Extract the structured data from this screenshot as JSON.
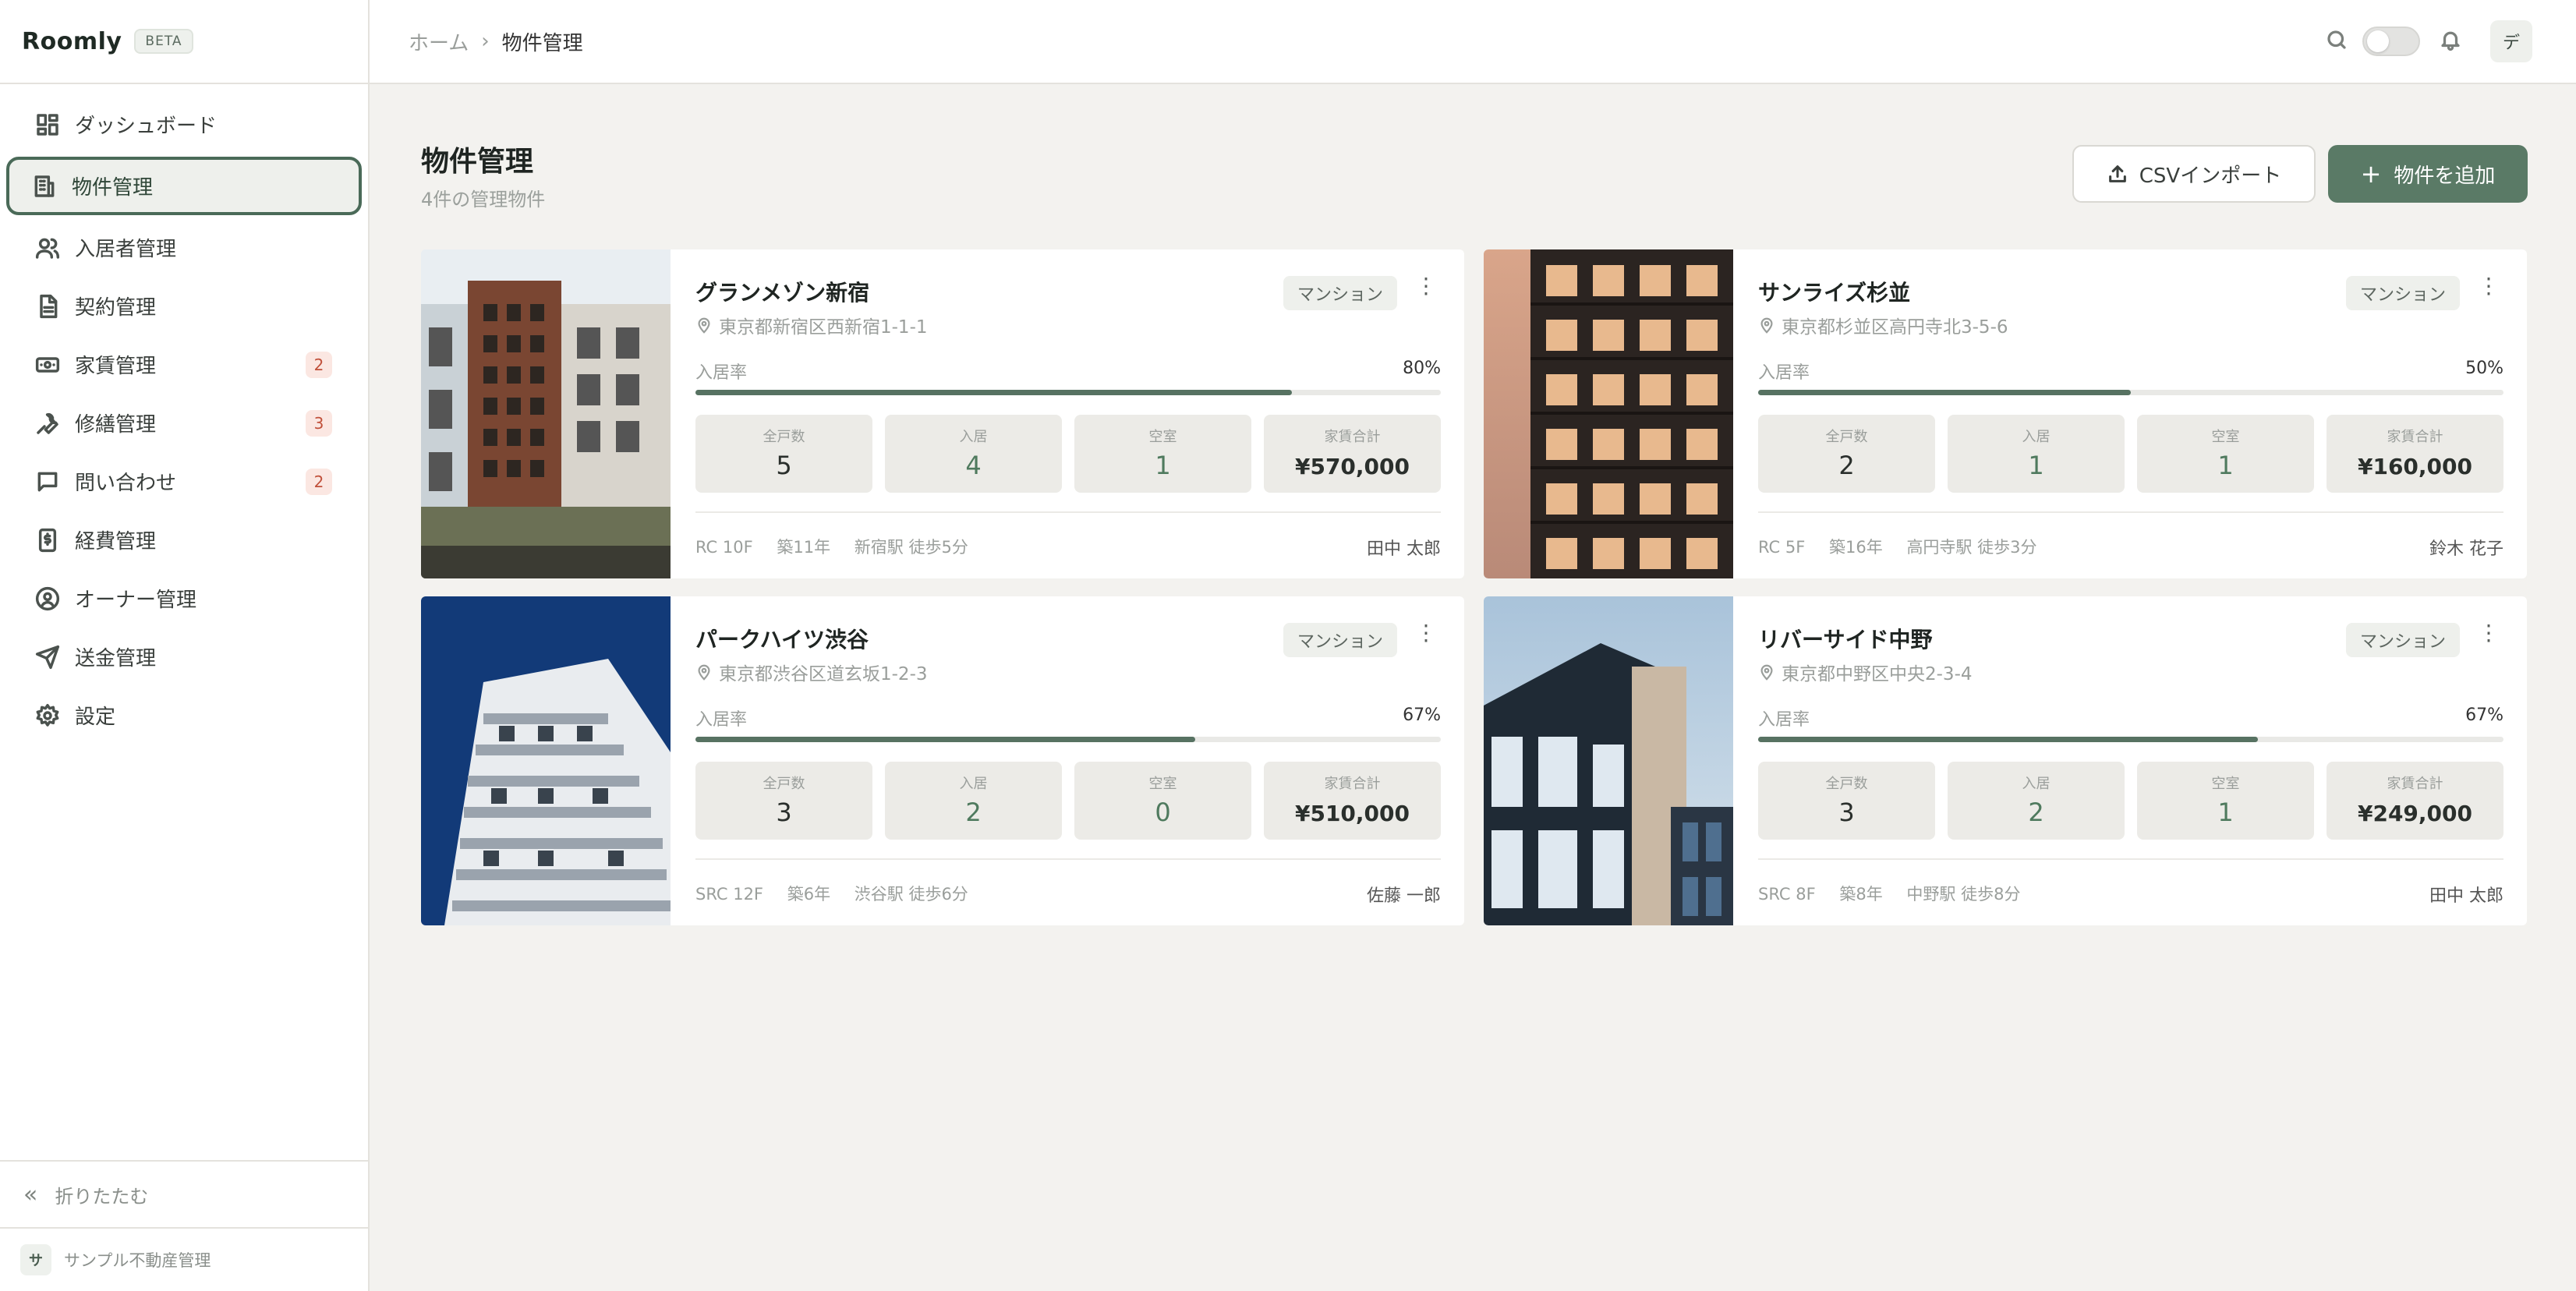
{
  "app": {
    "name": "Roomly",
    "badge": "BETA"
  },
  "sidebar": {
    "items": [
      {
        "label": "ダッシュボード",
        "icon": "dashboard-icon"
      },
      {
        "label": "物件管理",
        "icon": "building-icon",
        "active": true
      },
      {
        "label": "入居者管理",
        "icon": "users-icon"
      },
      {
        "label": "契約管理",
        "icon": "document-icon"
      },
      {
        "label": "家賃管理",
        "icon": "banknote-icon",
        "badge": "2"
      },
      {
        "label": "修繕管理",
        "icon": "wrench-icon",
        "badge": "3"
      },
      {
        "label": "問い合わせ",
        "icon": "message-icon",
        "badge": "2"
      },
      {
        "label": "経費管理",
        "icon": "receipt-icon"
      },
      {
        "label": "オーナー管理",
        "icon": "user-circle-icon"
      },
      {
        "label": "送金管理",
        "icon": "send-icon"
      },
      {
        "label": "設定",
        "icon": "gear-icon"
      }
    ],
    "collapse_label": "折りたたむ",
    "org_initial": "サ",
    "org_name": "サンプル不動産管理"
  },
  "topbar": {
    "breadcrumb_home": "ホーム",
    "breadcrumb_separator": "›",
    "breadcrumb_current": "物件管理",
    "user_initial": "デ"
  },
  "page": {
    "title": "物件管理",
    "subtitle": "4件の管理物件",
    "import_label": "CSVインポート",
    "add_label": "物件を追加"
  },
  "colors": {
    "accent": "#5a7a66",
    "badge_bg": "#fbe7e2",
    "badge_text": "#c0503a"
  },
  "properties": [
    {
      "name": "グランメゾン新宿",
      "address": "東京都新宿区西新宿1-1-1",
      "type": "マンション",
      "occupancy_label": "入居率",
      "occupancy": "80%",
      "occupancy_rate": 0.8,
      "stats": {
        "total_label": "全戸数",
        "total": "5",
        "occupied_label": "入居",
        "occupied": "4",
        "vacant_label": "空室",
        "vacant": "1",
        "rent_label": "家賃合計",
        "rent": "¥570,000"
      },
      "structure": "RC 10F",
      "age": "築11年",
      "station": "新宿駅 徒歩5分",
      "manager": "田中 太郎"
    },
    {
      "name": "サンライズ杉並",
      "address": "東京都杉並区高円寺北3-5-6",
      "type": "マンション",
      "occupancy_label": "入居率",
      "occupancy": "50%",
      "occupancy_rate": 0.5,
      "stats": {
        "total_label": "全戸数",
        "total": "2",
        "occupied_label": "入居",
        "occupied": "1",
        "vacant_label": "空室",
        "vacant": "1",
        "rent_label": "家賃合計",
        "rent": "¥160,000"
      },
      "structure": "RC 5F",
      "age": "築16年",
      "station": "高円寺駅 徒歩3分",
      "manager": "鈴木 花子"
    },
    {
      "name": "パークハイツ渋谷",
      "address": "東京都渋谷区道玄坂1-2-3",
      "type": "マンション",
      "occupancy_label": "入居率",
      "occupancy": "67%",
      "occupancy_rate": 0.67,
      "stats": {
        "total_label": "全戸数",
        "total": "3",
        "occupied_label": "入居",
        "occupied": "2",
        "vacant_label": "空室",
        "vacant": "0",
        "rent_label": "家賃合計",
        "rent": "¥510,000"
      },
      "structure": "SRC 12F",
      "age": "築6年",
      "station": "渋谷駅 徒歩6分",
      "manager": "佐藤 一郎"
    },
    {
      "name": "リバーサイド中野",
      "address": "東京都中野区中央2-3-4",
      "type": "マンション",
      "occupancy_label": "入居率",
      "occupancy": "67%",
      "occupancy_rate": 0.67,
      "stats": {
        "total_label": "全戸数",
        "total": "3",
        "occupied_label": "入居",
        "occupied": "2",
        "vacant_label": "空室",
        "vacant": "1",
        "rent_label": "家賃合計",
        "rent": "¥249,000"
      },
      "structure": "SRC 8F",
      "age": "築8年",
      "station": "中野駅 徒歩8分",
      "manager": "田中 太郎"
    }
  ]
}
